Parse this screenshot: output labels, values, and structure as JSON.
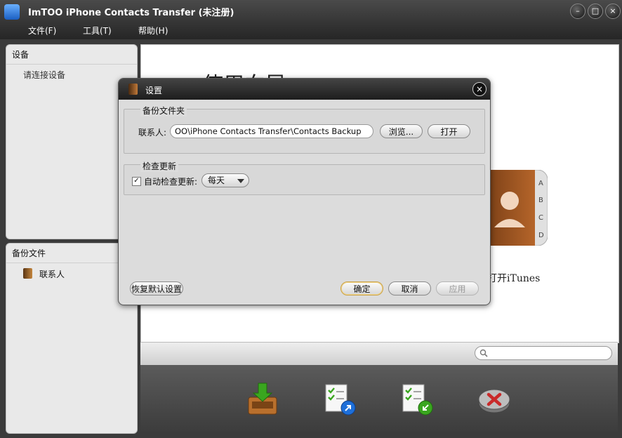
{
  "window": {
    "title": "ImTOO iPhone Contacts Transfer (未注册)",
    "minimize_glyph": "–",
    "maximize_glyph": "□",
    "close_glyph": "×"
  },
  "menu": {
    "file": "文件(F)",
    "tools": "工具(T)",
    "help": "帮助(H)"
  },
  "sidebar": {
    "devices_header": "设备",
    "connect_hint": "请连接设备",
    "backup_header": "备份文件",
    "backup_items": [
      {
        "label": "联系人",
        "icon": "contacts-book-icon"
      }
    ]
  },
  "main": {
    "guide_title": "使用向导",
    "open_itunes": "打开iTunes",
    "index_letters": [
      "A",
      "B",
      "C",
      "D"
    ]
  },
  "toolbar": {
    "icons": [
      "import-tray-icon",
      "export-document-icon",
      "import-document-icon",
      "delete-icon"
    ]
  },
  "dialog": {
    "title": "设置",
    "close_glyph": "×",
    "backup_group_label": "备份文件夹",
    "contacts_label": "联系人:",
    "backup_path": "OO\\iPhone Contacts Transfer\\Contacts Backup",
    "browse_button": "浏览...",
    "open_button": "打开",
    "update_group_label": "检查更新",
    "auto_check_label": "自动检查更新:",
    "auto_check_checked": true,
    "frequency": "每天",
    "restore_defaults_button": "恢复默认设置",
    "ok_button": "确定",
    "cancel_button": "取消",
    "apply_button": "应用"
  },
  "colors": {
    "titlebar": "#2e2e2e",
    "panel": "#e9e9e9",
    "dialog_bg": "#dcdcdc",
    "accent_green": "#3aa61f",
    "accent_blue": "#1e6fd9",
    "delete_red": "#c92a2a"
  }
}
